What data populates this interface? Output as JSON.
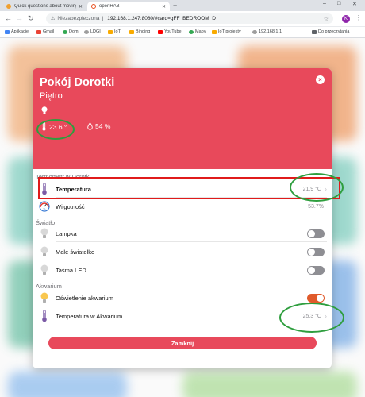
{
  "browser": {
    "tabs": [
      {
        "title": "Quick questions about moving o"
      },
      {
        "title": "openHAB"
      }
    ],
    "new_tab": "+",
    "window_controls": {
      "minimize": "–",
      "maximize": "□",
      "close": "✕"
    },
    "address_bar": {
      "security": "Niezabezpieczona",
      "url": "192.168.1.247:8080/#card=gFF_BEDROOM_D"
    },
    "profile_initial": "K",
    "bookmarks": [
      {
        "label": "Aplikacje"
      },
      {
        "label": "Gmail"
      },
      {
        "label": "Dom"
      },
      {
        "label": "LDGI"
      },
      {
        "label": "IoT"
      },
      {
        "label": "Binding"
      },
      {
        "label": "YouTube"
      },
      {
        "label": "Mapy"
      },
      {
        "label": "IoT projekty"
      },
      {
        "label": "192.168.1.1"
      }
    ],
    "bookmarks_right": "Do przeczytania"
  },
  "modal": {
    "title": "Pokój Dorotki",
    "subtitle": "Piętro",
    "close_icon": "×",
    "badges": {
      "temperature": "23.6 °",
      "humidity": "54 %"
    },
    "groups": [
      {
        "name": "Termometr w Dorotki",
        "items": [
          {
            "label": "Temperatura",
            "value": "21.9 °C"
          },
          {
            "label": "Wilgotność",
            "value": "53.7%"
          }
        ]
      },
      {
        "name": "Światło",
        "items": [
          {
            "label": "Lampka",
            "on": false
          },
          {
            "label": "Małe światełko",
            "on": false
          },
          {
            "label": "Taśma LED",
            "on": false
          }
        ]
      },
      {
        "name": "Akwarium",
        "items": [
          {
            "label": "Oświetlenie akwarium",
            "on": true
          },
          {
            "label": "Temperatura w Akwarium",
            "value": "25.3 °C"
          }
        ]
      }
    ],
    "chevron": "›",
    "close_button": "Zamknij"
  },
  "colors": {
    "header": "#e8495b",
    "toggle_on": "#e05a2b",
    "toggle_off": "#8e8e93",
    "annotation_green": "#2e9e3e",
    "annotation_red": "#e01b1b"
  }
}
